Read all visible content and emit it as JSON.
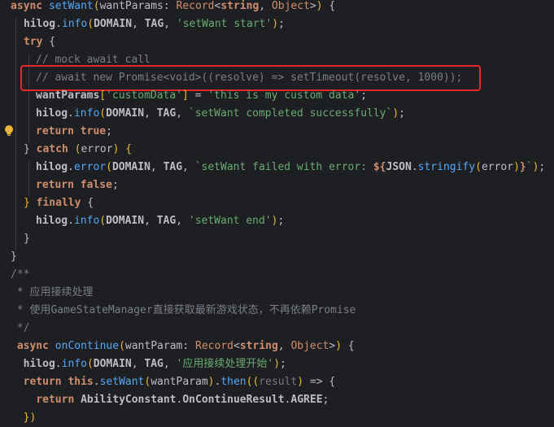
{
  "lines": [
    {
      "id": "l1",
      "indent": 0,
      "parts": [
        [
          "kw",
          "async "
        ],
        [
          "fn",
          "setWant"
        ],
        [
          "brk",
          "("
        ],
        [
          "param",
          "wantParams"
        ],
        [
          "pun",
          ": "
        ],
        [
          "type",
          "Record"
        ],
        [
          "pun",
          "<"
        ],
        [
          "kw",
          "string"
        ],
        [
          "pun",
          ", "
        ],
        [
          "type",
          "Object"
        ],
        [
          "pun",
          ">"
        ],
        [
          "brk",
          ")"
        ],
        [
          "pun",
          " {"
        ]
      ]
    },
    {
      "id": "l2",
      "indent": 1,
      "parts": [
        [
          "obj",
          "hilog"
        ],
        [
          "pun",
          "."
        ],
        [
          "fnc",
          "info"
        ],
        [
          "brk",
          "("
        ],
        [
          "const",
          "DOMAIN"
        ],
        [
          "pun",
          ", "
        ],
        [
          "const",
          "TAG"
        ],
        [
          "pun",
          ", "
        ],
        [
          "str",
          "'setWant start'"
        ],
        [
          "brk",
          ")"
        ],
        [
          "pun",
          ";"
        ]
      ]
    },
    {
      "id": "l3",
      "indent": 1,
      "parts": [
        [
          "kw",
          "try"
        ],
        [
          "pun",
          " {"
        ]
      ]
    },
    {
      "id": "l4",
      "indent": 2,
      "parts": [
        [
          "cm",
          "// mock await call"
        ]
      ]
    },
    {
      "id": "l5",
      "indent": 2,
      "parts": [
        [
          "cm",
          "// await new Promise<void>((resolve) => setTimeout(resolve, 1000));"
        ]
      ]
    },
    {
      "id": "l6",
      "indent": 2,
      "parts": [
        [
          "obj",
          "wantParams"
        ],
        [
          "brk",
          "["
        ],
        [
          "str",
          "'customData'"
        ],
        [
          "brk",
          "]"
        ],
        [
          "pun",
          " = "
        ],
        [
          "str",
          "'this is my custom data'"
        ],
        [
          "pun",
          ";"
        ]
      ]
    },
    {
      "id": "l7",
      "indent": 2,
      "parts": [
        [
          "obj",
          "hilog"
        ],
        [
          "pun",
          "."
        ],
        [
          "fnc",
          "info"
        ],
        [
          "brk",
          "("
        ],
        [
          "const",
          "DOMAIN"
        ],
        [
          "pun",
          ", "
        ],
        [
          "const",
          "TAG"
        ],
        [
          "pun",
          ", "
        ],
        [
          "tpl",
          "`setWant completed successfully`"
        ],
        [
          "brk",
          ")"
        ],
        [
          "pun",
          ";"
        ]
      ]
    },
    {
      "id": "l8",
      "indent": 2,
      "parts": [
        [
          "kw",
          "return "
        ],
        [
          "kw",
          "true"
        ],
        [
          "pun",
          ";"
        ]
      ]
    },
    {
      "id": "l9",
      "indent": 1,
      "parts": [
        [
          "pun",
          "} "
        ],
        [
          "kw",
          "catch "
        ],
        [
          "brk",
          "("
        ],
        [
          "param",
          "error"
        ],
        [
          "brk",
          ")"
        ],
        [
          "pun",
          " "
        ],
        [
          "brk",
          "{"
        ]
      ]
    },
    {
      "id": "l10",
      "indent": 2,
      "parts": [
        [
          "obj",
          "hilog"
        ],
        [
          "pun",
          "."
        ],
        [
          "fnc",
          "error"
        ],
        [
          "brk",
          "("
        ],
        [
          "const",
          "DOMAIN"
        ],
        [
          "pun",
          ", "
        ],
        [
          "const",
          "TAG"
        ],
        [
          "pun",
          ", "
        ],
        [
          "tpl",
          "`setWant failed with error: "
        ],
        [
          "kw",
          "${"
        ],
        [
          "obj",
          "JSON"
        ],
        [
          "pun",
          "."
        ],
        [
          "fnc",
          "stringify"
        ],
        [
          "brk",
          "("
        ],
        [
          "param",
          "error"
        ],
        [
          "brk",
          ")"
        ],
        [
          "kw",
          "}"
        ],
        [
          "tpl",
          "`"
        ],
        [
          "brk",
          ")"
        ],
        [
          "pun",
          ";"
        ]
      ]
    },
    {
      "id": "l11",
      "indent": 2,
      "parts": [
        [
          "kw",
          "return "
        ],
        [
          "kw",
          "false"
        ],
        [
          "pun",
          ";"
        ]
      ]
    },
    {
      "id": "l12",
      "indent": 1,
      "parts": [
        [
          "brk",
          "}"
        ],
        [
          "pun",
          " "
        ],
        [
          "kw",
          "finally"
        ],
        [
          "pun",
          " {"
        ]
      ]
    },
    {
      "id": "l13",
      "indent": 2,
      "parts": [
        [
          "obj",
          "hilog"
        ],
        [
          "pun",
          "."
        ],
        [
          "fnc",
          "info"
        ],
        [
          "brk",
          "("
        ],
        [
          "const",
          "DOMAIN"
        ],
        [
          "pun",
          ", "
        ],
        [
          "const",
          "TAG"
        ],
        [
          "pun",
          ", "
        ],
        [
          "str",
          "'setWant end'"
        ],
        [
          "brk",
          ")"
        ],
        [
          "pun",
          ";"
        ]
      ]
    },
    {
      "id": "l14",
      "indent": 1,
      "parts": [
        [
          "pun",
          "}"
        ]
      ]
    },
    {
      "id": "l15",
      "indent": 0,
      "parts": [
        [
          "pun",
          "}"
        ]
      ]
    },
    {
      "id": "l16",
      "indent": 0,
      "parts": [
        [
          "cm",
          "/**"
        ]
      ]
    },
    {
      "id": "l17",
      "indent": 0,
      "parts": [
        [
          "cm",
          " * 应用接续处理"
        ]
      ]
    },
    {
      "id": "l18",
      "indent": 0,
      "parts": [
        [
          "cm",
          " * 使用GameStateManager直接获取最新游戏状态，不再依赖Promise"
        ]
      ]
    },
    {
      "id": "l19",
      "indent": 0,
      "parts": [
        [
          "cm",
          " */"
        ]
      ]
    },
    {
      "id": "l20",
      "indent": 0,
      "parts": [
        [
          "pun",
          " "
        ],
        [
          "kw",
          "async "
        ],
        [
          "fn",
          "onContinue"
        ],
        [
          "brk",
          "("
        ],
        [
          "param",
          "wantParam"
        ],
        [
          "pun",
          ": "
        ],
        [
          "type",
          "Record"
        ],
        [
          "pun",
          "<"
        ],
        [
          "kw",
          "string"
        ],
        [
          "pun",
          ", "
        ],
        [
          "type",
          "Object"
        ],
        [
          "pun",
          ">"
        ],
        [
          "brk",
          ")"
        ],
        [
          "pun",
          " {"
        ]
      ]
    },
    {
      "id": "l21",
      "indent": 0,
      "parts": [
        [
          "pun",
          "  "
        ],
        [
          "obj",
          "hilog"
        ],
        [
          "pun",
          "."
        ],
        [
          "fnc",
          "info"
        ],
        [
          "brk",
          "("
        ],
        [
          "const",
          "DOMAIN"
        ],
        [
          "pun",
          ", "
        ],
        [
          "const",
          "TAG"
        ],
        [
          "pun",
          ", "
        ],
        [
          "str",
          "'应用接续处理开始'"
        ],
        [
          "brk",
          ")"
        ],
        [
          "pun",
          ";"
        ]
      ]
    },
    {
      "id": "l22",
      "indent": 0,
      "parts": [
        [
          "pun",
          "  "
        ],
        [
          "kw",
          "return "
        ],
        [
          "kw",
          "this"
        ],
        [
          "pun",
          "."
        ],
        [
          "fnc",
          "setWant"
        ],
        [
          "brk",
          "("
        ],
        [
          "param",
          "wantParam"
        ],
        [
          "brk",
          ")"
        ],
        [
          "pun",
          "."
        ],
        [
          "fnc",
          "then"
        ],
        [
          "brk",
          "("
        ],
        [
          "brk",
          "("
        ],
        [
          "unused",
          "result"
        ],
        [
          "brk",
          ")"
        ],
        [
          "pun",
          " => {"
        ]
      ]
    },
    {
      "id": "l23",
      "indent": 0,
      "parts": [
        [
          "pun",
          "    "
        ],
        [
          "kw",
          "return "
        ],
        [
          "obj",
          "AbilityConstant"
        ],
        [
          "pun",
          "."
        ],
        [
          "obj",
          "OnContinueResult"
        ],
        [
          "pun",
          "."
        ],
        [
          "const",
          "AGREE"
        ],
        [
          "pun",
          ";"
        ]
      ]
    },
    {
      "id": "l24",
      "indent": 0,
      "parts": [
        [
          "pun",
          "  "
        ],
        [
          "brk",
          "})"
        ]
      ]
    }
  ]
}
